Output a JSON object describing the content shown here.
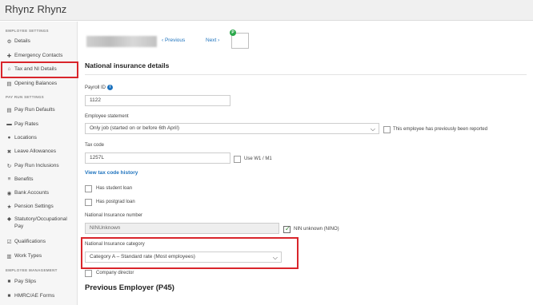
{
  "app": {
    "title": "Rhynz Rhynz"
  },
  "sidebar": {
    "employee_settings_label": "EMPLOYEE SETTINGS",
    "pay_run_settings_label": "PAY RUN SETTINGS",
    "employee_management_label": "EMPLOYEE MANAGEMENT",
    "items": [
      {
        "label": "Details",
        "icon": "gear-icon",
        "glyph": "⚙"
      },
      {
        "label": "Emergency Contacts",
        "icon": "plus-icon",
        "glyph": "✚"
      },
      {
        "label": "Tax and NI Details",
        "icon": "bank-icon",
        "glyph": "⌂"
      },
      {
        "label": "Opening Balances",
        "icon": "ledger-icon",
        "glyph": "▤"
      },
      {
        "label": "Pay Run Defaults",
        "icon": "document-icon",
        "glyph": "▤"
      },
      {
        "label": "Pay Rates",
        "icon": "money-icon",
        "glyph": "▬"
      },
      {
        "label": "Locations",
        "icon": "globe-icon",
        "glyph": "●"
      },
      {
        "label": "Leave Allowances",
        "icon": "scissors-icon",
        "glyph": "✖"
      },
      {
        "label": "Pay Run Inclusions",
        "icon": "refresh-icon",
        "glyph": "↻"
      },
      {
        "label": "Benefits",
        "icon": "chart-icon",
        "glyph": "≡"
      },
      {
        "label": "Bank Accounts",
        "icon": "bank-circle-icon",
        "glyph": "◉"
      },
      {
        "label": "Pension Settings",
        "icon": "star-icon",
        "glyph": "★"
      },
      {
        "label": "Statutory/Occupational Pay",
        "icon": "tag-icon",
        "glyph": "◆"
      },
      {
        "label": "Qualifications",
        "icon": "checklist-icon",
        "glyph": "☑"
      },
      {
        "label": "Work Types",
        "icon": "clipboard-icon",
        "glyph": "▥"
      },
      {
        "label": "Pay Slips",
        "icon": "payslip-icon",
        "glyph": "■"
      },
      {
        "label": "HMRC/AE Forms",
        "icon": "form-icon",
        "glyph": "■"
      }
    ]
  },
  "header": {
    "previous_label": "‹ Previous",
    "next_label": "Next ›",
    "logo_badge": "P"
  },
  "form": {
    "section_title": "National insurance details",
    "payroll_id_label": "Payroll ID",
    "payroll_id_value": "1122",
    "employee_statement_label": "Employee statement",
    "employee_statement_value": "Only job (started on or before 6th April)",
    "previously_reported_label": "This employee has previously been reported",
    "tax_code_label": "Tax code",
    "tax_code_value": "1257L",
    "use_w1_m1_label": "Use W1 / M1",
    "view_tax_code_history": "View tax code history",
    "has_student_loan_label": "Has student loan",
    "has_postgrad_loan_label": "Has postgrad loan",
    "ni_number_label": "National Insurance number",
    "ni_number_value": "NINUnknown",
    "nin_unknown_label": "NIN unknown (NINO)",
    "ni_category_label": "National Insurance category",
    "ni_category_value": "Category A – Standard rate (Most employees)",
    "company_director_label": "Company director",
    "previous_employer_title": "Previous Employer (P45)"
  },
  "colors": {
    "highlight": "#d9252b",
    "link": "#1e73be"
  }
}
